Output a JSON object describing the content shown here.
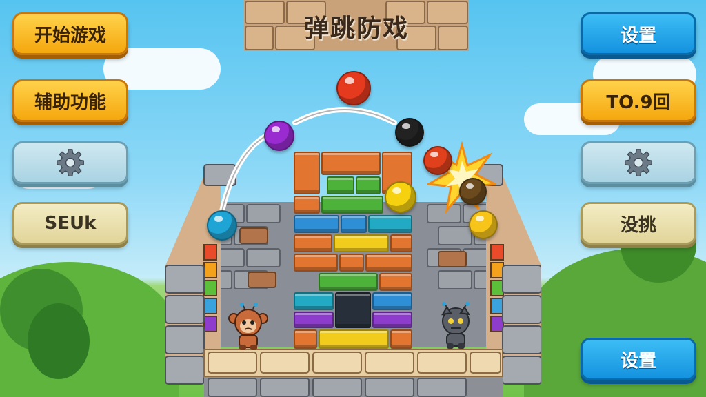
{
  "title": "弹跳防戏",
  "left_menu": {
    "start_label": "开始游戏",
    "assist_label": "辅助功能",
    "gear_icon": "gear-icon",
    "seuk_label": "SEUk"
  },
  "right_menu": {
    "settings_top_label": "设置",
    "round_label": "TO.9回",
    "gear_icon": "gear-icon",
    "challenge_label": "没挑",
    "settings_bottom_label": "设置"
  },
  "colors": {
    "sky": "#56c4f0",
    "grass": "#6fc24a",
    "orange_button": "#f5a70e",
    "blue_button": "#1492df",
    "pale_button": "#a9d3e3",
    "cream_button": "#e2d59a"
  },
  "balls": [
    {
      "name": "red",
      "color": "#e63a1e"
    },
    {
      "name": "purple",
      "color": "#9a2bd0"
    },
    {
      "name": "black",
      "color": "#222222"
    },
    {
      "name": "cyan",
      "color": "#1fa4d6"
    },
    {
      "name": "yellow",
      "color": "#f5d10f"
    },
    {
      "name": "red-small",
      "color": "#e0401c"
    },
    {
      "name": "brown",
      "color": "#6b4a1e"
    },
    {
      "name": "yellow-face",
      "color": "#f7c41a"
    }
  ],
  "characters": [
    "monkey-guard",
    "robot-guard"
  ]
}
